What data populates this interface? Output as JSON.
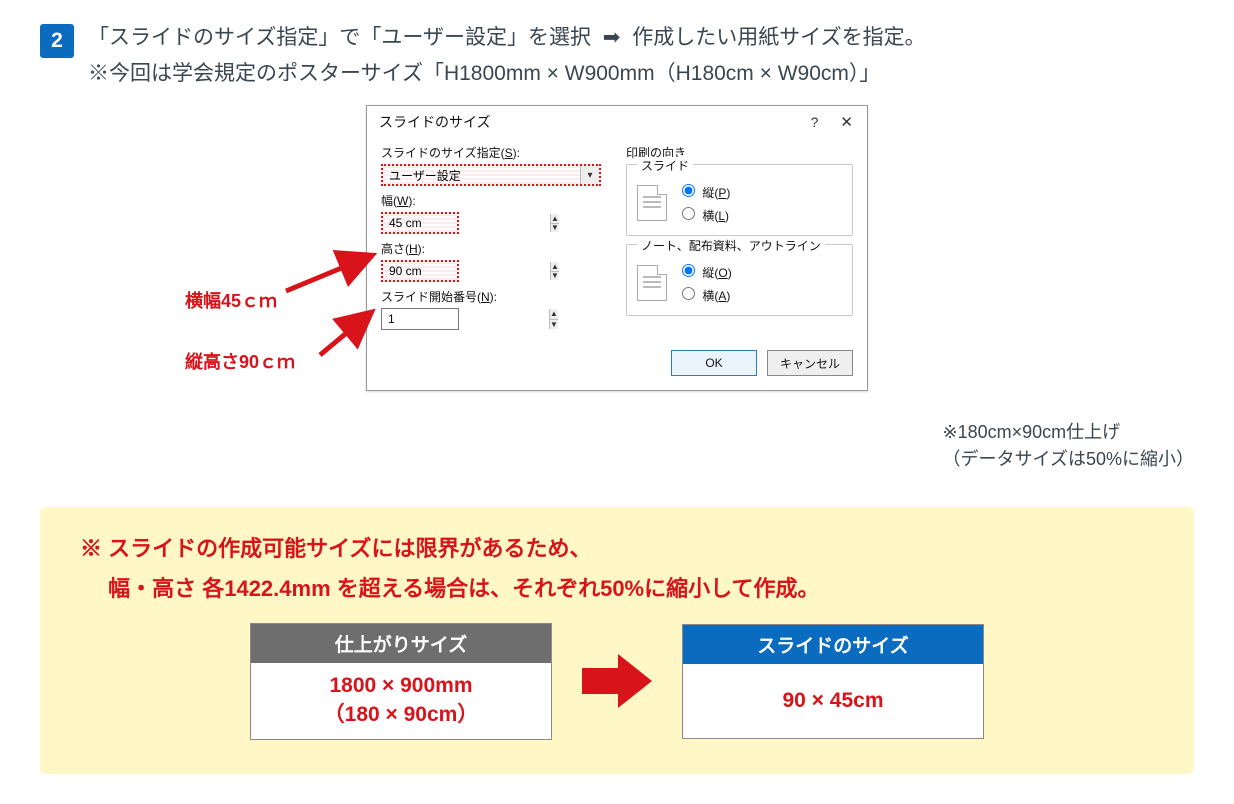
{
  "step": {
    "number": "2",
    "line1_a": "「スライドのサイズ指定」で「ユーザー設定」を選択",
    "line1_b": "作成したい用紙サイズを指定。",
    "line2": "※今回は学会規定のポスターサイズ「H1800mm × W900mm（H180cm × W90cm）」"
  },
  "dialog": {
    "title": "スライドのサイズ",
    "labels": {
      "size_spec": "スライドのサイズ指定(",
      "size_spec_u": "S",
      "size_spec_end": "):",
      "width": "幅(",
      "width_u": "W",
      "width_end": "):",
      "height": "高さ(",
      "height_u": "H",
      "height_end": "):",
      "start_no": "スライド開始番号(",
      "start_no_u": "N",
      "start_no_end": "):"
    },
    "values": {
      "preset": "ユーザー設定",
      "width": "45 cm",
      "height": "90 cm",
      "start_no": "1"
    },
    "orientation": {
      "group_title": "印刷の向き",
      "slide_legend": "スライド",
      "slide_portrait": "縦(",
      "slide_portrait_u": "P",
      "slide_portrait_end": ")",
      "slide_landscape": "横(",
      "slide_landscape_u": "L",
      "slide_landscape_end": ")",
      "notes_legend": "ノート、配布資料、アウトライン",
      "notes_portrait_u": "O",
      "notes_landscape_u": "A"
    },
    "buttons": {
      "ok": "OK",
      "cancel": "キャンセル"
    }
  },
  "callouts": {
    "width": "横幅45ｃｍ",
    "height": "縦高さ90ｃｍ"
  },
  "right_note": {
    "line1": "※180cm×90cm仕上げ",
    "line2": "（データサイズは50%に縮小）"
  },
  "note": {
    "heading_l1": "※ スライドの作成可能サイズには限界があるため、",
    "heading_l2": "　 幅・高さ 各1422.4mm を超える場合は、それぞれ50%に縮小して作成。",
    "left_card": {
      "head": "仕上がりサイズ",
      "body_l1": "1800 × 900mm",
      "body_l2": "（180 × 90cm）"
    },
    "right_card": {
      "head": "スライドのサイズ",
      "body_l1": "90 × 45cm"
    }
  }
}
